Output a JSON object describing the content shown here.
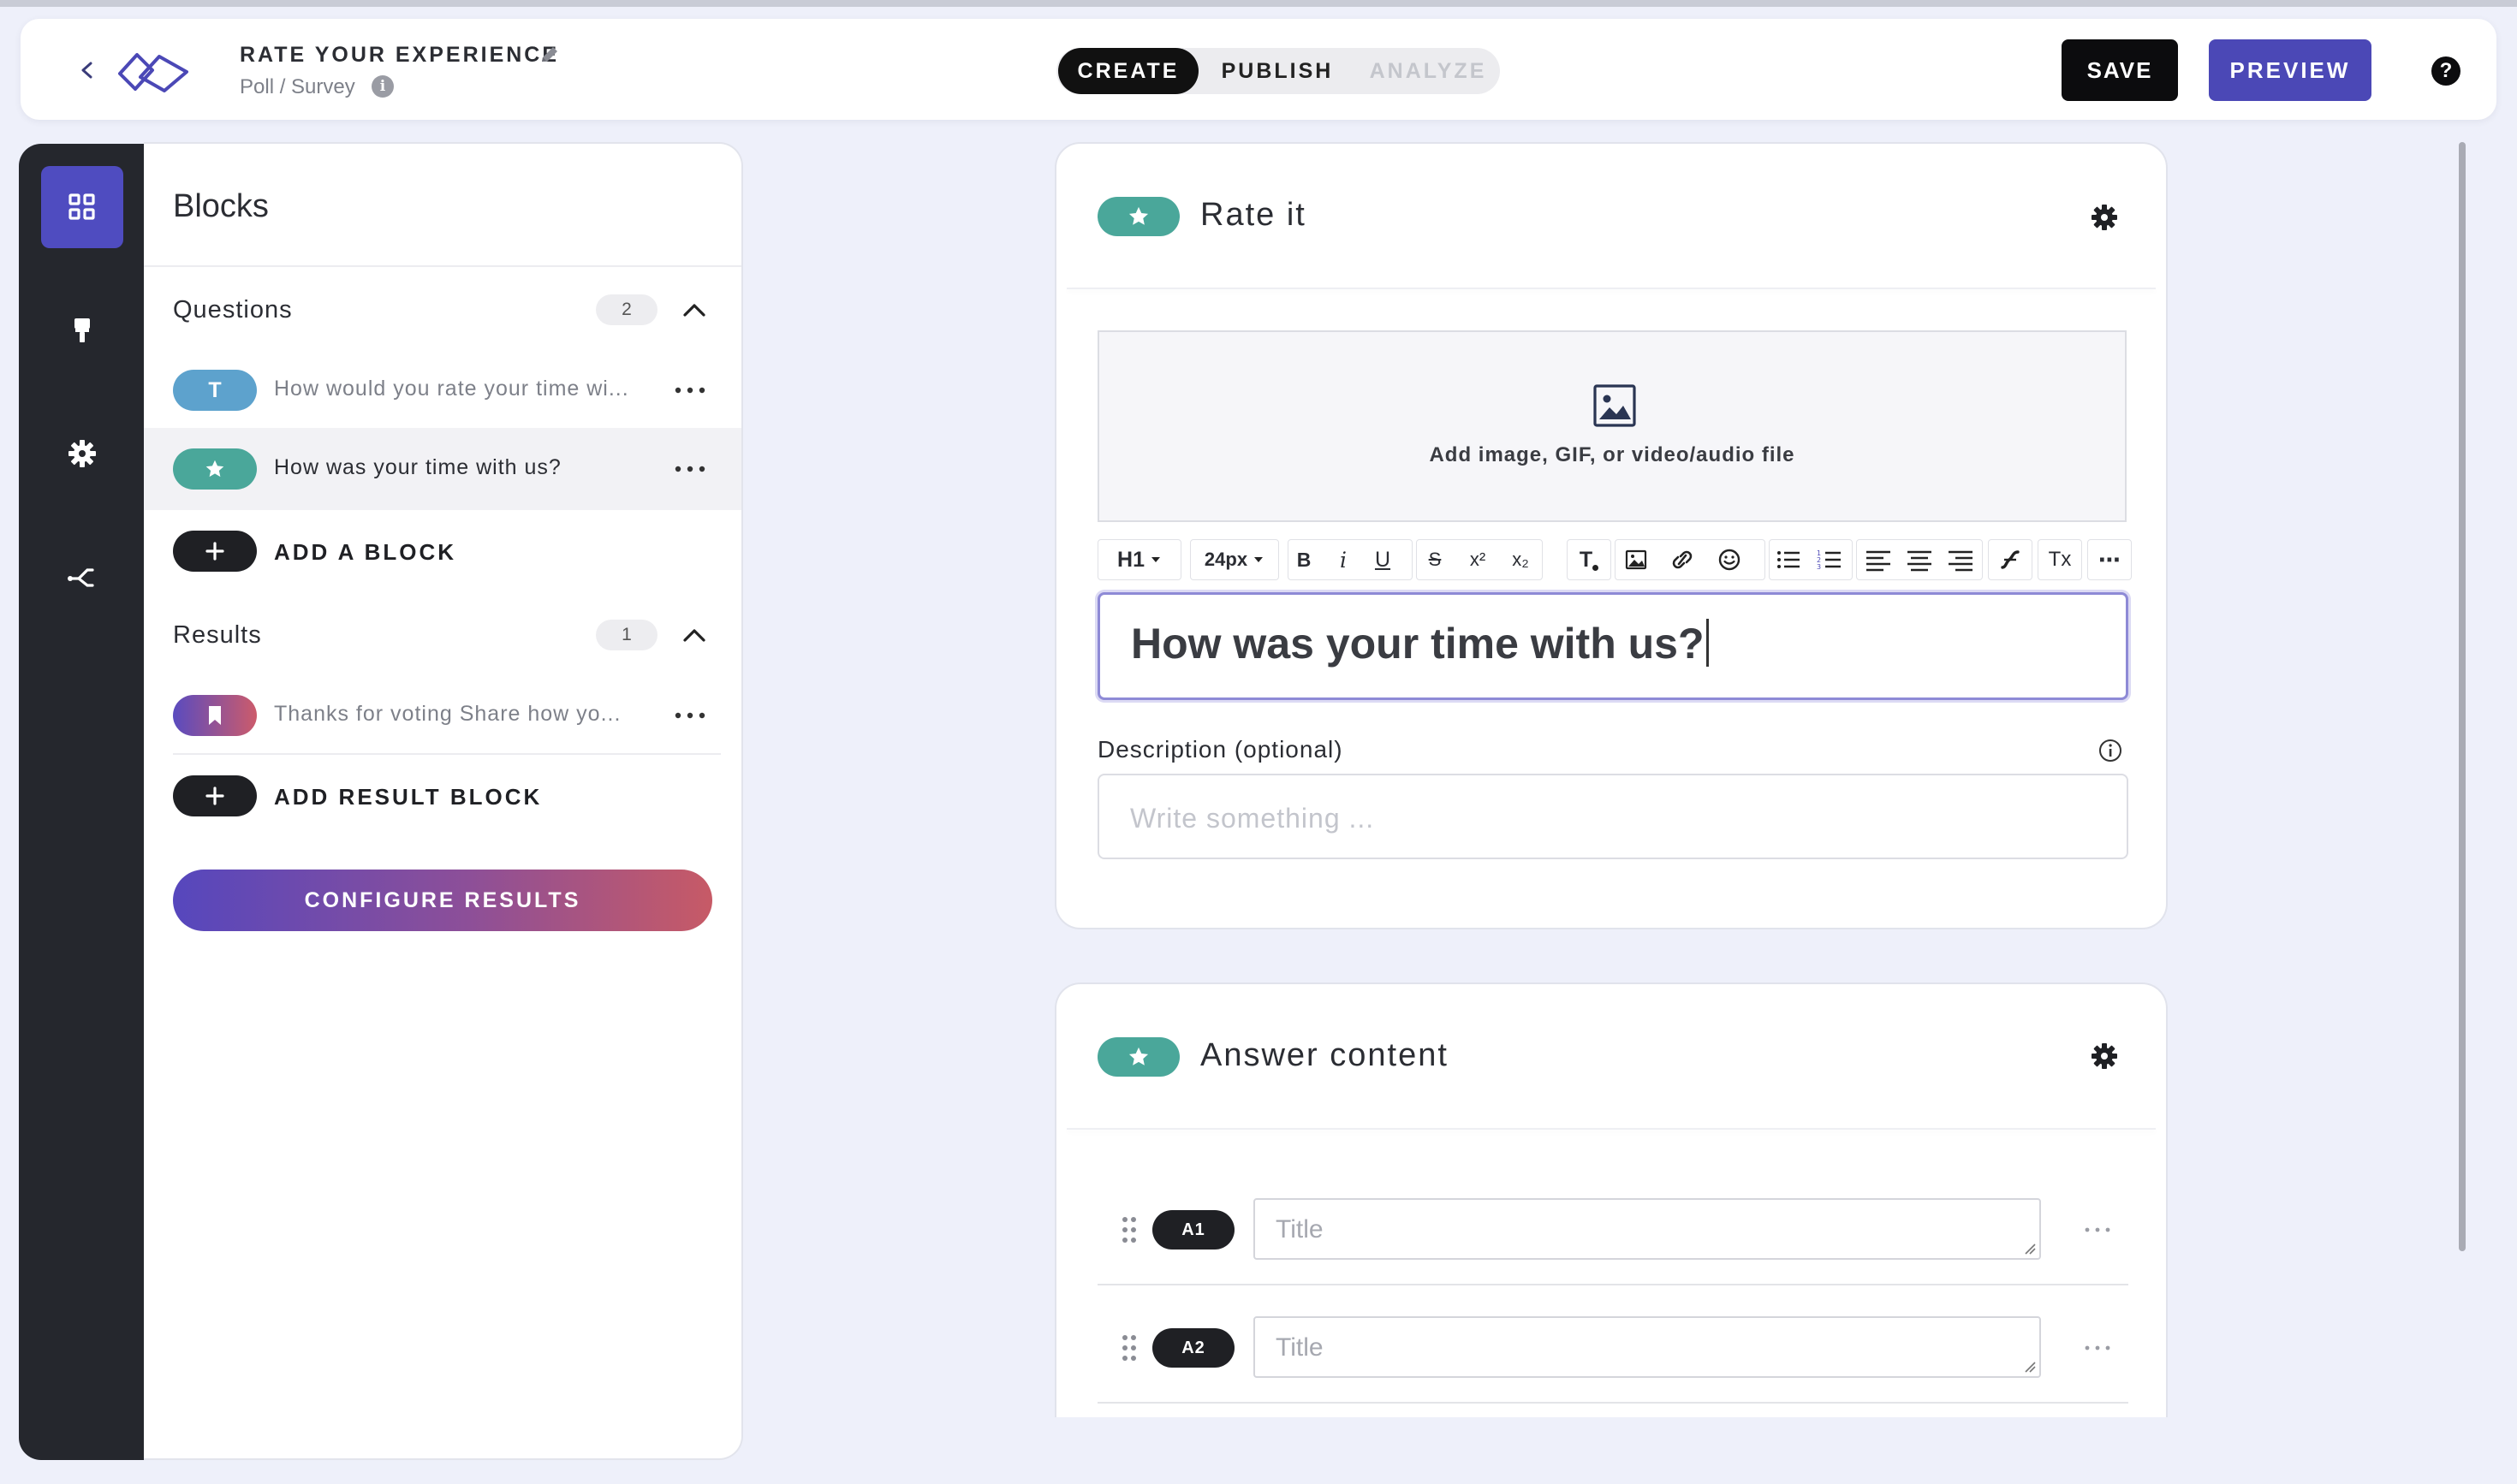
{
  "header": {
    "title": "RATE YOUR EXPERIENCE",
    "subtitle": "Poll / Survey",
    "modes": [
      "CREATE",
      "PUBLISH",
      "ANALYZE"
    ],
    "active_mode": "CREATE",
    "save_label": "SAVE",
    "preview_label": "PREVIEW",
    "help_label": "?",
    "info_label": "i"
  },
  "rail": {
    "items": [
      "blocks-icon",
      "paint-roller-icon",
      "gear-icon",
      "branch-icon"
    ],
    "active": "blocks-icon"
  },
  "blocks_panel": {
    "title": "Blocks",
    "questions": {
      "label": "Questions",
      "count": "2",
      "items": [
        {
          "badge": "T",
          "badge_color": "#5da2cd",
          "text": "How would you rate your time wi..."
        },
        {
          "badge": "star",
          "badge_color": "#4aa79a",
          "text": "How was your time with us?",
          "selected": true
        }
      ],
      "add_label": "ADD A BLOCK"
    },
    "results": {
      "label": "Results",
      "count": "1",
      "items": [
        {
          "badge": "bookmark",
          "text": "Thanks for voting Share how yo..."
        }
      ],
      "add_label": "ADD RESULT BLOCK"
    },
    "configure_label": "CONFIGURE RESULTS"
  },
  "rate_card": {
    "title": "Rate it",
    "media_prompt": "Add image, GIF, or video/audio file",
    "toolbar": {
      "heading": "H1",
      "font_size": "24px",
      "bold": "B",
      "italic": "i",
      "underline": "U",
      "strike": "S",
      "superscript": "x²",
      "subscript": "x₂",
      "text_color": "T",
      "clear_format": "Tx",
      "more": "⋯"
    },
    "headline": "How was your time with us?",
    "description_label": "Description (optional)",
    "description_placeholder": "Write something ..."
  },
  "answer_card": {
    "title": "Answer content",
    "answers": [
      {
        "label": "A1",
        "placeholder": "Title"
      },
      {
        "label": "A2",
        "placeholder": "Title"
      }
    ]
  },
  "colors": {
    "accent": "#4b48b6",
    "teal": "#4aa79a",
    "rail_bg": "#25272d",
    "page_bg": "#eef0fa"
  }
}
